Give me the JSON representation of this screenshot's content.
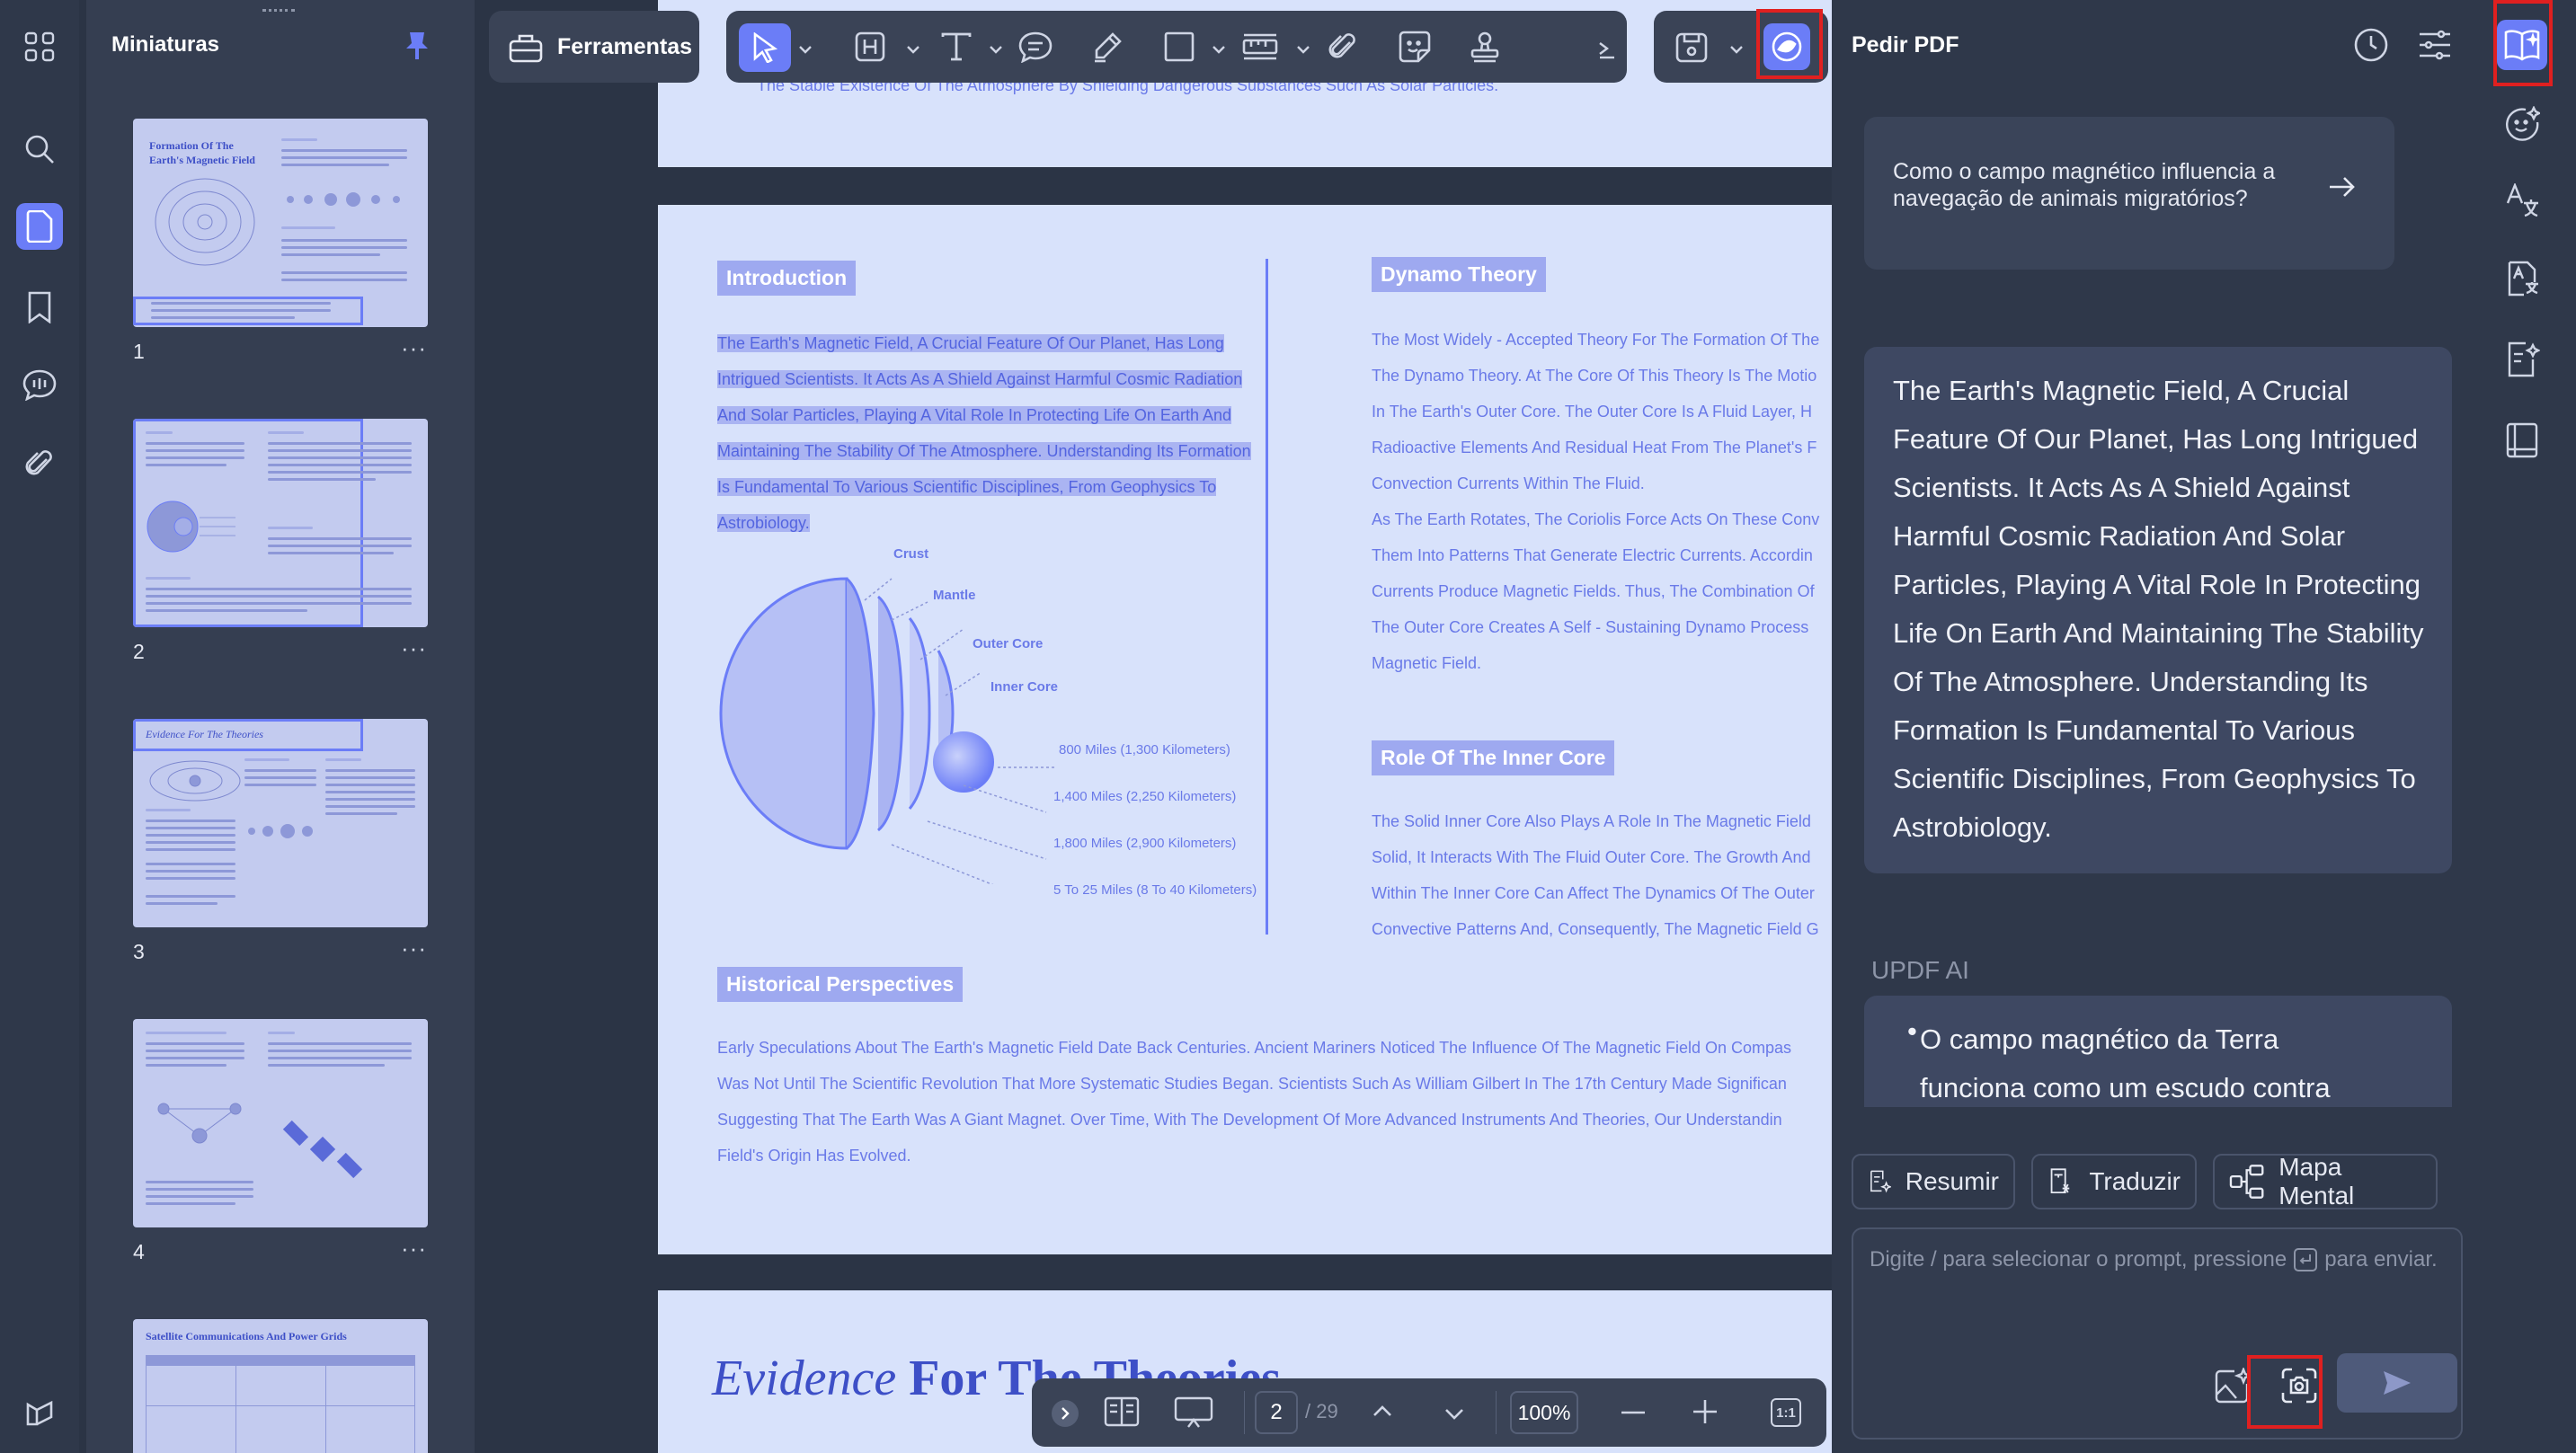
{
  "left_rail": {
    "icons": [
      "grid-icon",
      "search-icon",
      "pages-icon",
      "bookmark-icon",
      "comments-icon",
      "attachment-icon",
      "layers-icon"
    ]
  },
  "thumbnails": {
    "title": "Miniaturas",
    "pages": [
      {
        "number": "1",
        "heading": "Formation Of The Earth's Magnetic Field"
      },
      {
        "number": "2",
        "heading": ""
      },
      {
        "number": "3",
        "heading": "Evidence For The Theories"
      },
      {
        "number": "4",
        "heading": ""
      },
      {
        "number": "",
        "heading": "Satellite Communications And Power Grids"
      }
    ],
    "more_label": "···"
  },
  "toolbar": {
    "tools_label": "Ferramentas"
  },
  "document": {
    "top_line": "The Stable Existence Of The Atmosphere By Shielding Dangerous Substances Such As Solar Particles.",
    "intro": {
      "heading": "Introduction",
      "lines": [
        "The Earth's Magnetic Field, A Crucial Feature Of Our Planet, Has Long",
        "Intrigued Scientists. It Acts As A Shield Against Harmful Cosmic Radiation",
        "And Solar Particles, Playing A Vital Role In Protecting Life On Earth And",
        "Maintaining The Stability Of The Atmosphere. Understanding Its Formation",
        "Is Fundamental To Various Scientific Disciplines, From Geophysics To",
        "Astrobiology."
      ]
    },
    "diagram": {
      "labels": [
        "Crust",
        "Mantle",
        "Outer Core",
        "Inner Core"
      ],
      "depths": [
        "800 Miles (1,300 Kilometers)",
        "1,400 Miles (2,250 Kilometers)",
        "1,800 Miles (2,900 Kilometers)",
        "5 To 25 Miles (8 To 40 Kilometers)"
      ]
    },
    "dynamo": {
      "heading": "Dynamo Theory",
      "lines": [
        "The Most Widely - Accepted Theory For The Formation Of The",
        "The Dynamo Theory. At The Core Of This Theory Is The Motio",
        "In The Earth's Outer Core. The Outer Core Is A Fluid Layer, H",
        "Radioactive Elements And Residual Heat From The Planet's F",
        "Convection Currents Within The Fluid.",
        "As The Earth Rotates, The Coriolis Force Acts On These Conv",
        "Them Into Patterns That Generate Electric Currents. Accordin",
        "Currents Produce Magnetic Fields. Thus, The Combination Of",
        "The Outer Core Creates A Self - Sustaining Dynamo Process",
        "Magnetic Field."
      ]
    },
    "inner_core": {
      "heading": "Role Of The Inner Core",
      "lines": [
        "The Solid Inner Core Also Plays A Role In The Magnetic Field",
        "Solid, It Interacts With The Fluid Outer Core. The Growth And",
        "Within The Inner Core Can Affect The Dynamics Of The Outer",
        "Convective Patterns And, Consequently, The Magnetic Field G"
      ]
    },
    "history": {
      "heading": "Historical Perspectives",
      "lines": [
        "Early Speculations About The Earth's Magnetic Field Date Back Centuries. Ancient Mariners Noticed The Influence Of The Magnetic Field On Compas",
        "Was Not Until The Scientific Revolution That More Systematic Studies Began. Scientists Such As William Gilbert In The 17th Century Made Significan",
        "Suggesting That The Earth Was A Giant Magnet. Over Time, With The Development Of More Advanced Instruments And Theories, Our Understandin",
        "Field's Origin Has Evolved."
      ]
    },
    "next_title_italic": "Evidence",
    "next_title_bold": "For The Theories"
  },
  "bottom_bar": {
    "page_current": "2",
    "page_total": "/ 29",
    "zoom": "100%",
    "fit_label": "1:1"
  },
  "ai_panel": {
    "title": "Pedir PDF",
    "suggestion": "Como o campo magnético influencia a navegação de animais migratórios?",
    "quote_lines": [
      "The Earth's Magnetic Field, A Crucial",
      "Feature Of Our Planet, Has Long Intrigued",
      "Scientists. It Acts As A Shield Against",
      "Harmful Cosmic Radiation And Solar",
      "Particles, Playing A Vital Role In Protecting",
      "Life On Earth And Maintaining The Stability",
      "Of The Atmosphere. Understanding Its",
      "Formation Is Fundamental To Various",
      "Scientific Disciplines, From Geophysics To",
      "Astrobiology."
    ],
    "assistant_name": "UPDF AI",
    "answer_lines": [
      "O campo magnético da Terra",
      "funciona como um escudo contra"
    ],
    "bullet": "•",
    "actions": {
      "summarize": "Resumir",
      "translate": "Traduzir",
      "mindmap": "Mapa Mental"
    },
    "input_placeholder_before": "Digite / para selecionar o prompt, pressione",
    "input_placeholder_after": "para enviar."
  },
  "colors": {
    "accent": "#6b7df7",
    "highlight_box": "#e02020",
    "page_bg": "#d8e2fb",
    "page_text": "#6a7ae8"
  }
}
